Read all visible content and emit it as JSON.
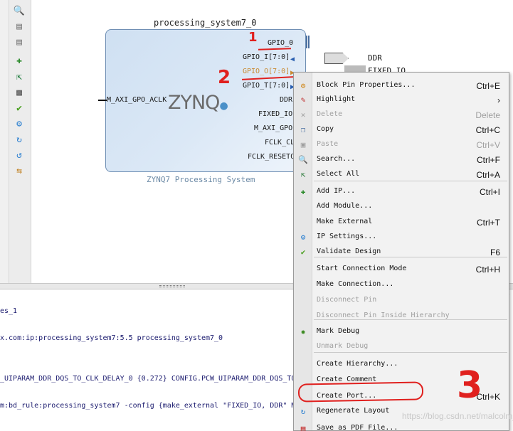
{
  "block": {
    "title": "processing_system7_0",
    "subtitle": "ZYNQ7 Processing System",
    "logo": "ZYNQ",
    "left_pin": "M_AXI_GPO_ACLK",
    "right_pins": [
      "GPIO_0",
      "GPIO_I[7:0]",
      "GPIO_O[7:0]",
      "GPIO_T[7:0]",
      "DDR",
      "FIXED_IO",
      "M_AXI_GPO",
      "FCLK_CL",
      "FCLK_RESETO"
    ]
  },
  "outputs": [
    "DDR",
    "FIXED_IO"
  ],
  "annotations": {
    "one": "1",
    "two": "2",
    "three": "3"
  },
  "menu": {
    "items": [
      {
        "label": "Block Pin Properties...",
        "shortcut": "Ctrl+E",
        "icon": "properties-icon",
        "disabled": false
      },
      {
        "label": "Highlight",
        "shortcut": "›",
        "icon": "highlight-icon",
        "disabled": false
      },
      {
        "label": "Delete",
        "shortcut": "Delete",
        "icon": "delete-icon",
        "disabled": true
      },
      {
        "label": "Copy",
        "shortcut": "Ctrl+C",
        "icon": "copy-icon",
        "disabled": false
      },
      {
        "label": "Paste",
        "shortcut": "Ctrl+V",
        "icon": "paste-icon",
        "disabled": true
      },
      {
        "label": "Search...",
        "shortcut": "Ctrl+F",
        "icon": "search-icon",
        "disabled": false
      },
      {
        "label": "Select All",
        "shortcut": "Ctrl+A",
        "icon": "select-all-icon",
        "disabled": false
      },
      {
        "label": "Add IP...",
        "shortcut": "Ctrl+I",
        "icon": "add-ip-icon",
        "disabled": false
      },
      {
        "label": "Add Module...",
        "shortcut": "",
        "icon": "",
        "disabled": false
      },
      {
        "label": "Make External",
        "shortcut": "Ctrl+T",
        "icon": "",
        "disabled": false
      },
      {
        "label": "IP Settings...",
        "shortcut": "",
        "icon": "ip-settings-icon",
        "disabled": false
      },
      {
        "label": "Validate Design",
        "shortcut": "F6",
        "icon": "validate-icon",
        "disabled": false
      },
      {
        "label": "Start Connection Mode",
        "shortcut": "Ctrl+H",
        "icon": "",
        "disabled": false
      },
      {
        "label": "Make Connection...",
        "shortcut": "",
        "icon": "",
        "disabled": false
      },
      {
        "label": "Disconnect Pin",
        "shortcut": "",
        "icon": "",
        "disabled": true
      },
      {
        "label": "Disconnect Pin Inside Hierarchy",
        "shortcut": "",
        "icon": "",
        "disabled": true
      },
      {
        "label": "Mark Debug",
        "shortcut": "",
        "icon": "mark-debug-icon",
        "disabled": false
      },
      {
        "label": "Unmark Debug",
        "shortcut": "",
        "icon": "",
        "disabled": true
      },
      {
        "label": "Create Hierarchy...",
        "shortcut": "",
        "icon": "",
        "disabled": false
      },
      {
        "label": "Create Comment",
        "shortcut": "",
        "icon": "",
        "disabled": false
      },
      {
        "label": "Create Port...",
        "shortcut": "Ctrl+K",
        "icon": "",
        "disabled": false
      },
      {
        "label": "Regenerate Layout",
        "shortcut": "",
        "icon": "regenerate-icon",
        "disabled": false
      },
      {
        "label": "Save as PDF File...",
        "shortcut": "",
        "icon": "pdf-icon",
        "disabled": false
      }
    ]
  },
  "console": {
    "lines": [
      "es_1",
      "x.com:ip:processing_system7:5.5 processing_system7_0",
      "_UIPARAM_DDR_DQS_TO_CLK_DELAY_0 {0.272} CONFIG.PCW_UIPARAM_DDR_DQS_TO",
      "m:bd_rule:processing_system7 -config {make_external \"FIXED_IO, DDR\" M"
    ]
  },
  "watermark": "https://blog.csdn.net/malcolm_110"
}
